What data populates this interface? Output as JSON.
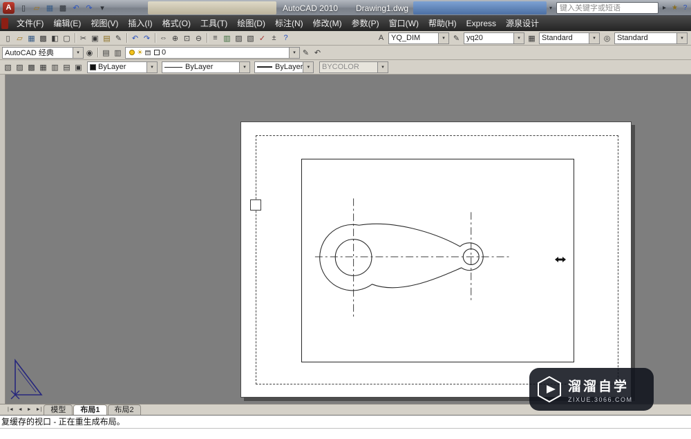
{
  "ui": {
    "chevron_down": "▾",
    "sun": "☀",
    "nav_first": "|◄",
    "nav_prev": "◄",
    "nav_next": "►",
    "nav_last": "►|"
  },
  "titlebar": {
    "app_icon": "A",
    "qat_icons": [
      {
        "name": "qnew-icon",
        "glyph": "▯"
      },
      {
        "name": "open-icon",
        "glyph": "▱",
        "tint": "#a3761c"
      },
      {
        "name": "save-icon",
        "glyph": "▦",
        "tint": "#365a85"
      },
      {
        "name": "plot-icon",
        "glyph": "▩"
      },
      {
        "name": "undo-icon",
        "glyph": "↶",
        "tint": "#2a52be"
      },
      {
        "name": "redo-icon",
        "glyph": "↷",
        "tint": "#2a52be"
      },
      {
        "name": "qat-menu-chevron-icon",
        "glyph": "▾"
      }
    ],
    "title_left": "AutoCAD 2010",
    "title_right": "Drawing1.dwg",
    "search_placeholder": "键入关键字或短语",
    "infocenter_icons": [
      {
        "name": "search-go-icon",
        "glyph": "▸"
      },
      {
        "name": "favorites-star-icon",
        "glyph": "★",
        "tint": "#8a6d1f"
      },
      {
        "name": "help-icon",
        "glyph": "?",
        "tint": "#2a52be"
      }
    ]
  },
  "menubar": {
    "items": [
      {
        "name": "menu-file",
        "label": "文件(F)"
      },
      {
        "name": "menu-edit",
        "label": "编辑(E)"
      },
      {
        "name": "menu-view",
        "label": "视图(V)"
      },
      {
        "name": "menu-insert",
        "label": "插入(I)"
      },
      {
        "name": "menu-format",
        "label": "格式(O)"
      },
      {
        "name": "menu-tools",
        "label": "工具(T)"
      },
      {
        "name": "menu-draw",
        "label": "绘图(D)"
      },
      {
        "name": "menu-dimension",
        "label": "标注(N)"
      },
      {
        "name": "menu-modify",
        "label": "修改(M)"
      },
      {
        "name": "menu-parametric",
        "label": "参数(P)"
      },
      {
        "name": "menu-window",
        "label": "窗口(W)"
      },
      {
        "name": "menu-help",
        "label": "帮助(H)"
      },
      {
        "name": "menu-express",
        "label": "Express"
      },
      {
        "name": "menu-yuanquan-design",
        "label": "源泉设计"
      }
    ]
  },
  "toolbars": {
    "standard": {
      "groups": [
        [
          {
            "name": "qnew-icon",
            "glyph": "▯"
          },
          {
            "name": "open-icon",
            "glyph": "▱",
            "tint": "#a3761c"
          },
          {
            "name": "save-icon",
            "glyph": "▦",
            "tint": "#365a85"
          },
          {
            "name": "plot-icon",
            "glyph": "▩"
          },
          {
            "name": "plot-preview-icon",
            "glyph": "◧"
          },
          {
            "name": "publish-icon",
            "glyph": "▢"
          }
        ],
        [
          {
            "name": "cut-icon",
            "glyph": "✂"
          },
          {
            "name": "copy-icon",
            "glyph": "▣"
          },
          {
            "name": "paste-icon",
            "glyph": "▤",
            "tint": "#8a6d1f"
          },
          {
            "name": "match-properties-icon",
            "glyph": "✎"
          }
        ],
        [
          {
            "name": "undo-icon",
            "glyph": "↶",
            "tint": "#2a52be"
          },
          {
            "name": "redo-icon",
            "glyph": "↷",
            "tint": "#2a52be"
          }
        ],
        [
          {
            "name": "pan-icon",
            "glyph": "⇔"
          },
          {
            "name": "zoom-realtime-icon",
            "glyph": "⊕"
          },
          {
            "name": "zoom-window-icon",
            "glyph": "⊡"
          },
          {
            "name": "zoom-previous-icon",
            "glyph": "⊖"
          }
        ],
        [
          {
            "name": "properties-palette-icon",
            "glyph": "≡"
          },
          {
            "name": "designcenter-icon",
            "glyph": "▥",
            "tint": "#3b6a3b"
          },
          {
            "name": "tool-palettes-icon",
            "glyph": "▨"
          },
          {
            "name": "sheet-set-manager-icon",
            "glyph": "▧"
          },
          {
            "name": "markup-icon",
            "glyph": "✓",
            "tint": "#a33"
          },
          {
            "name": "quickcalc-icon",
            "glyph": "±"
          },
          {
            "name": "help-icon",
            "glyph": "?",
            "tint": "#2a52be"
          }
        ]
      ]
    },
    "styles": {
      "text_style_icon": "A",
      "pencil_icon": "✎",
      "table_style_icon": "▦",
      "mleader_style_icon": "◎",
      "dim_style": "YQ_DIM",
      "text_style": "yq20",
      "table_style": "Standard",
      "mleader_style": "Standard"
    },
    "workspace": {
      "value": "AutoCAD 经典",
      "gear_icon": "◉"
    },
    "layers": {
      "manager_icon": "▤",
      "states_icon": "▥",
      "current": "0",
      "make_current_icon": "✎",
      "previous_icon": "↶"
    },
    "properties": {
      "layer_tool_icons": [
        {
          "name": "layer-tool-icon",
          "glyph": "▧"
        },
        {
          "name": "layer-tool-icon",
          "glyph": "▨"
        },
        {
          "name": "layer-tool-icon",
          "glyph": "▩"
        },
        {
          "name": "layer-tool-icon",
          "glyph": "▦"
        },
        {
          "name": "layer-tool-icon",
          "glyph": "▥"
        },
        {
          "name": "layer-tool-icon",
          "glyph": "▤"
        },
        {
          "name": "layer-tool-icon",
          "glyph": "▣"
        }
      ],
      "color": "ByLayer",
      "linetype": "ByLayer",
      "lineweight": "ByLayer",
      "plot_style": "BYCOLOR"
    }
  },
  "tabs": {
    "model": "模型",
    "layout1": "布局1",
    "layout2": "布局2",
    "active": "布局1"
  },
  "command": {
    "message": "复缓存的视口 - 正在重生成布局。"
  },
  "watermark": {
    "brand": "溜溜自学",
    "site": "zixue.3066.com"
  }
}
